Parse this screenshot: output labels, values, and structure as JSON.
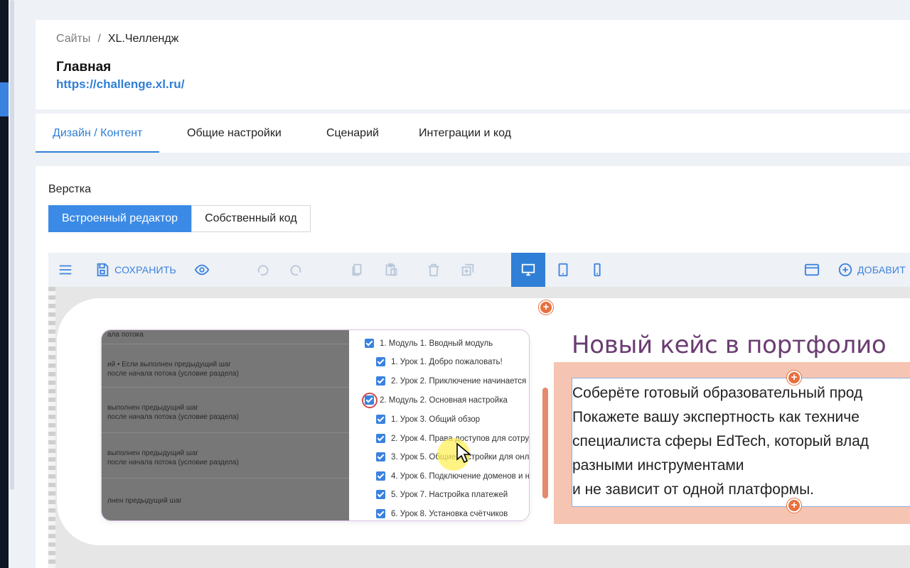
{
  "breadcrumb": {
    "root": "Сайты",
    "separator": "/",
    "current": "XL.Челлендж"
  },
  "page": {
    "title": "Главная",
    "url": "https://challenge.xl.ru/"
  },
  "tabs": [
    {
      "label": "Дизайн / Контент",
      "active": true
    },
    {
      "label": "Общие настройки",
      "active": false
    },
    {
      "label": "Сценарий",
      "active": false
    },
    {
      "label": "Интеграции и код",
      "active": false
    }
  ],
  "layout": {
    "label": "Верстка",
    "options": [
      {
        "label": "Встроенный редактор",
        "active": true
      },
      {
        "label": "Собственный код",
        "active": false
      }
    ]
  },
  "toolbar": {
    "save_label": "СОХРАНИТЬ",
    "add_label": "ДОБАВИТ",
    "active_device": "desktop",
    "icons": [
      "menu-icon",
      "save-icon",
      "eye-icon",
      "undo-icon",
      "redo-icon",
      "copy-icon",
      "paste-icon",
      "trash-icon",
      "duplicate-icon",
      "desktop-icon",
      "tablet-icon",
      "phone-icon",
      "window-icon",
      "plus-circle-icon"
    ]
  },
  "embedded_screenshot": {
    "left_rows": [
      {
        "lines": [
          "ала потока"
        ]
      },
      {
        "lines": [
          "ий  •  Если выполнен предыдущий шаг",
          "после начала потока (условие раздела)"
        ]
      },
      {
        "lines": [
          "выполнен предыдущий шаг",
          "после начала потока (условие раздела)"
        ]
      },
      {
        "lines": [
          "выполнен предыдущий шаг",
          "после начала потока (условие раздела)"
        ]
      },
      {
        "lines": [
          "лнен предыдущий шаг"
        ]
      }
    ],
    "checklist": [
      "1. Модуль 1. Вводный модуль",
      "1. Урок 1. Добро пожаловать!",
      "2. Урок 2. Приключение начинается",
      "2. Модуль 2. Основная настройка",
      "1. Урок 3. Общий обзор",
      "2. Урок 4. Права доступов для сотруд",
      "3. Урок 5. Общие настройки для онл",
      "4. Урок 6. Подключение доменов и н",
      "5. Урок 7. Настройка платежей",
      "6. Урок 8. Установка счётчиков"
    ]
  },
  "case": {
    "title": "Новый кейс в портфолио",
    "text_lines": [
      "Соберёте готовый образовательный прод",
      "Покажете вашу экспертность как техниче",
      "специалиста сферы EdTech, который влад",
      "разными инструментами",
      "и не зависит от одной платформы."
    ]
  },
  "colors": {
    "accent": "#2f7fd6",
    "case_title": "#6b3d72",
    "block_bg": "#f6c4b2",
    "plus": "#e8703f"
  }
}
